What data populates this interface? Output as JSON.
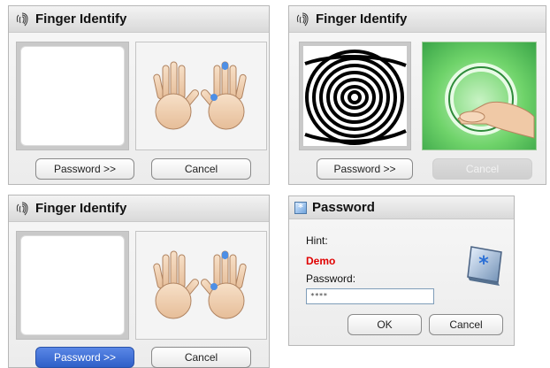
{
  "dialogs": [
    {
      "title": "Finger Identify",
      "password_button": "Password >>",
      "cancel_button": "Cancel"
    },
    {
      "title": "Finger Identify",
      "password_button": "Password >>",
      "cancel_button": "Cancel"
    },
    {
      "title": "Finger Identify",
      "password_button": "Password >>",
      "cancel_button": "Cancel"
    }
  ],
  "password_dialog": {
    "title": "Password",
    "hint_label": "Hint:",
    "hint_value": "Demo",
    "password_label": "Password:",
    "password_value": "****",
    "ok_button": "OK",
    "cancel_button": "Cancel"
  },
  "colors": {
    "hint": "#e00000",
    "selected_button": "#2e5fc8",
    "selected_fingertip": "#4d8fe6"
  },
  "icons": {
    "title_icon": "fingerprint-icon",
    "password_title_icon": "key-icon",
    "password_key_icon": "keyboard-key-icon"
  }
}
